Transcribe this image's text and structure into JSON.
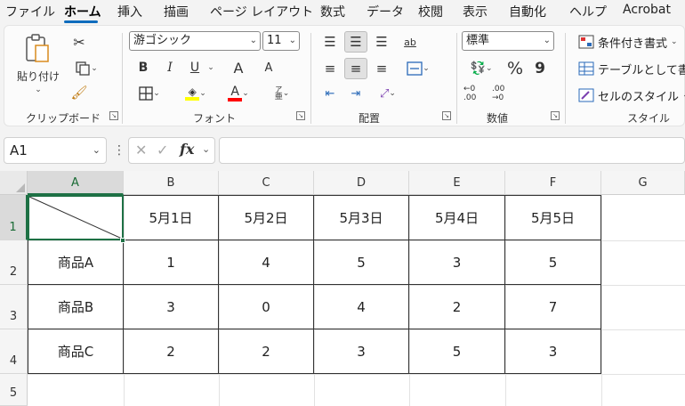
{
  "menu": {
    "items": [
      "ファイル",
      "ホーム",
      "挿入",
      "描画",
      "ページ レイアウト",
      "数式",
      "データ",
      "校閲",
      "表示",
      "自動化",
      "ヘルプ",
      "Acrobat"
    ],
    "active": "ホーム"
  },
  "ribbon": {
    "clipboard": {
      "paste_label": "貼り付け",
      "group_label": "クリップボード"
    },
    "font": {
      "font_name": "游ゴシック",
      "font_size": "11",
      "bold": "B",
      "italic": "I",
      "underline": "U",
      "grow": "A",
      "shrink": "A",
      "font_color_glyph": "A",
      "phonetic_top": "ア",
      "phonetic_bottom": "亜",
      "highlight_color": "#ffff00",
      "font_color": "#ff0000",
      "group_label": "フォント"
    },
    "alignment": {
      "wrap_glyph": "ab",
      "group_label": "配置"
    },
    "number": {
      "format": "標準",
      "percent": "%",
      "comma": "9",
      "inc_decimal": "←0 .00",
      "dec_decimal": ".00 →0",
      "group_label": "数値"
    },
    "styles": {
      "conditional": "条件付き書式",
      "table": "テーブルとして書式",
      "cell_style": "セルのスタイル",
      "group_label": "スタイル"
    }
  },
  "formula_bar": {
    "name_box": "A1",
    "fx": "fx",
    "formula": ""
  },
  "sheet": {
    "columns": [
      "A",
      "B",
      "C",
      "D",
      "E",
      "F",
      "G"
    ],
    "rows": [
      "1",
      "2",
      "3",
      "4",
      "5"
    ],
    "header_row": [
      "",
      "5月1日",
      "5月2日",
      "5月3日",
      "5月4日",
      "5月5日"
    ],
    "data_rows": [
      [
        "商品A",
        "1",
        "4",
        "5",
        "3",
        "5"
      ],
      [
        "商品B",
        "3",
        "0",
        "4",
        "2",
        "7"
      ],
      [
        "商品C",
        "2",
        "2",
        "3",
        "5",
        "3"
      ]
    ],
    "selected_cell": "A1",
    "accent_color": "#1e7145"
  }
}
